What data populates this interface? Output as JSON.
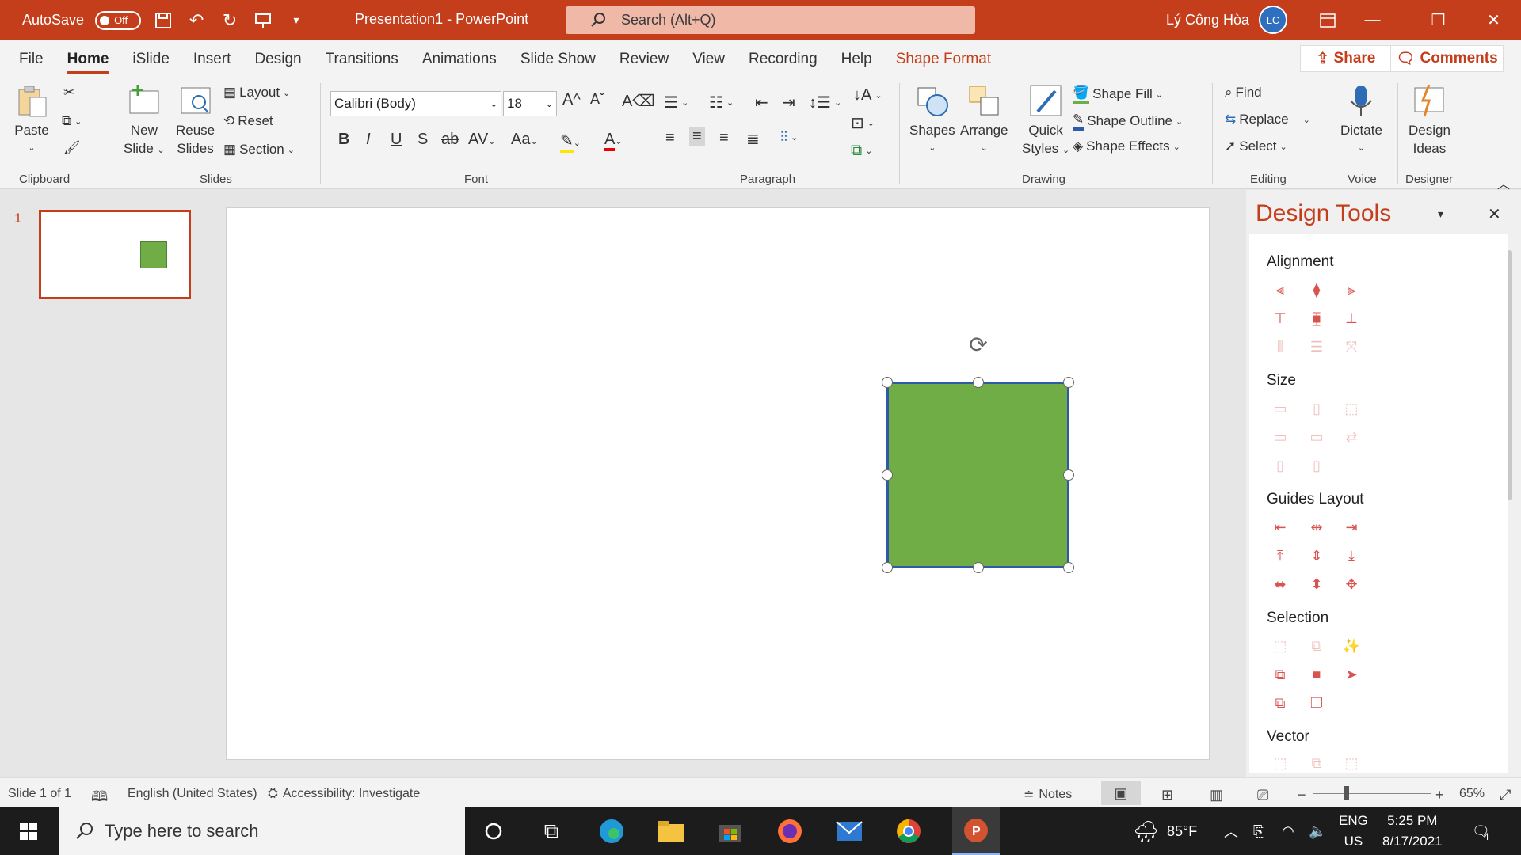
{
  "titlebar": {
    "autosave_label": "AutoSave",
    "autosave_state": "Off",
    "doc_title": "Presentation1  -  PowerPoint",
    "search_placeholder": "Search (Alt+Q)",
    "user_name": "Lý Công Hòa",
    "user_initials": "LC"
  },
  "tabs": [
    "File",
    "Home",
    "iSlide",
    "Insert",
    "Design",
    "Transitions",
    "Animations",
    "Slide Show",
    "Review",
    "View",
    "Recording",
    "Help",
    "Shape Format"
  ],
  "share_label": "Share",
  "comments_label": "Comments",
  "ribbon": {
    "clipboard": {
      "paste": "Paste",
      "group": "Clipboard"
    },
    "slides": {
      "new_slide_1": "New",
      "new_slide_2": "Slide",
      "reuse_1": "Reuse",
      "reuse_2": "Slides",
      "layout": "Layout",
      "reset": "Reset",
      "section": "Section",
      "group": "Slides"
    },
    "font": {
      "font_name": "Calibri (Body)",
      "font_size": "18",
      "group": "Font"
    },
    "paragraph": {
      "group": "Paragraph"
    },
    "drawing": {
      "shapes": "Shapes",
      "arrange": "Arrange",
      "quick_1": "Quick",
      "quick_2": "Styles",
      "fill": "Shape Fill",
      "outline": "Shape Outline",
      "effects": "Shape Effects",
      "group": "Drawing"
    },
    "editing": {
      "find": "Find",
      "replace": "Replace",
      "select": "Select",
      "group": "Editing"
    },
    "voice": {
      "dictate": "Dictate",
      "group": "Voice"
    },
    "designer": {
      "ideas_1": "Design",
      "ideas_2": "Ideas",
      "group": "Designer"
    }
  },
  "thumbnails": {
    "slide_number": "1"
  },
  "design_tools": {
    "title": "Design Tools",
    "sections": [
      "Alignment",
      "Size",
      "Guides Layout",
      "Selection",
      "Vector"
    ]
  },
  "status": {
    "slide_info": "Slide 1 of 1",
    "language": "English (United States)",
    "accessibility": "Accessibility: Investigate",
    "notes": "Notes",
    "zoom": "65%"
  },
  "taskbar": {
    "search_placeholder": "Type here to search",
    "weather": "85°F",
    "lang_1": "ENG",
    "lang_2": "US",
    "time": "5:25 PM",
    "date": "8/17/2021",
    "notification_count": "4"
  },
  "colors": {
    "accent": "#c43e1c",
    "shape_fill": "#70ad47",
    "shape_border": "#2e5aa8"
  }
}
